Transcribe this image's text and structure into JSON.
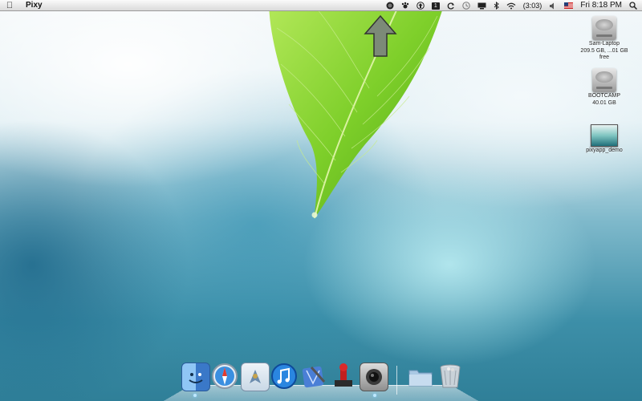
{
  "menubar": {
    "app_name": "Pixy",
    "battery": "(3:03)",
    "clock": "Fri 8:18 PM",
    "status_icons": [
      "record-icon",
      "paw-icon",
      "upload-icon",
      "one-password-icon",
      "sync-icon",
      "time-machine-icon",
      "display-icon",
      "bluetooth-icon",
      "wifi-icon",
      "battery-icon",
      "volume-icon",
      "flag-icon",
      "spotlight-icon"
    ]
  },
  "desktop_icons": [
    {
      "name": "Sam-Laptop",
      "info": "209.5 GB, ...01 GB free",
      "kind": "hard-drive-icon"
    },
    {
      "name": "BOOTCAMP",
      "info": "40.01 GB",
      "kind": "hard-drive-icon"
    },
    {
      "name": "pixyapp_demo",
      "info": "",
      "kind": "movie-thumbnail"
    }
  ],
  "dock": {
    "apps": [
      "finder-icon",
      "safari-icon",
      "mail-icon",
      "itunes-icon",
      "xcode-icon",
      "stamp-app-icon",
      "camera-app-icon"
    ],
    "stacks": [
      "folder-stack-icon",
      "trash-icon"
    ]
  },
  "overlay": {
    "pointer": "up-arrow-icon"
  }
}
